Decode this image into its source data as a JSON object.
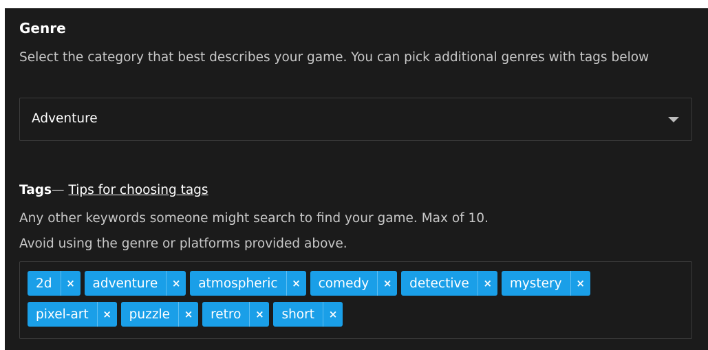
{
  "genre": {
    "title": "Genre",
    "description": "Select the category that best describes your game. You can pick additional genres with tags below",
    "selected": "Adventure"
  },
  "tags": {
    "title": "Tags",
    "dash": "—",
    "tips_link": "Tips for choosing tags",
    "description_1": "Any other keywords someone might search to find your game. Max of 10.",
    "description_2": "Avoid using the genre or platforms provided above.",
    "remove_glyph": "×",
    "items": [
      "2d",
      "adventure",
      "atmospheric",
      "comedy",
      "detective",
      "mystery",
      "pixel-art",
      "puzzle",
      "retro",
      "short"
    ]
  },
  "colors": {
    "tag_background": "#1a9fe8",
    "panel_background": "#1b1b1b"
  }
}
